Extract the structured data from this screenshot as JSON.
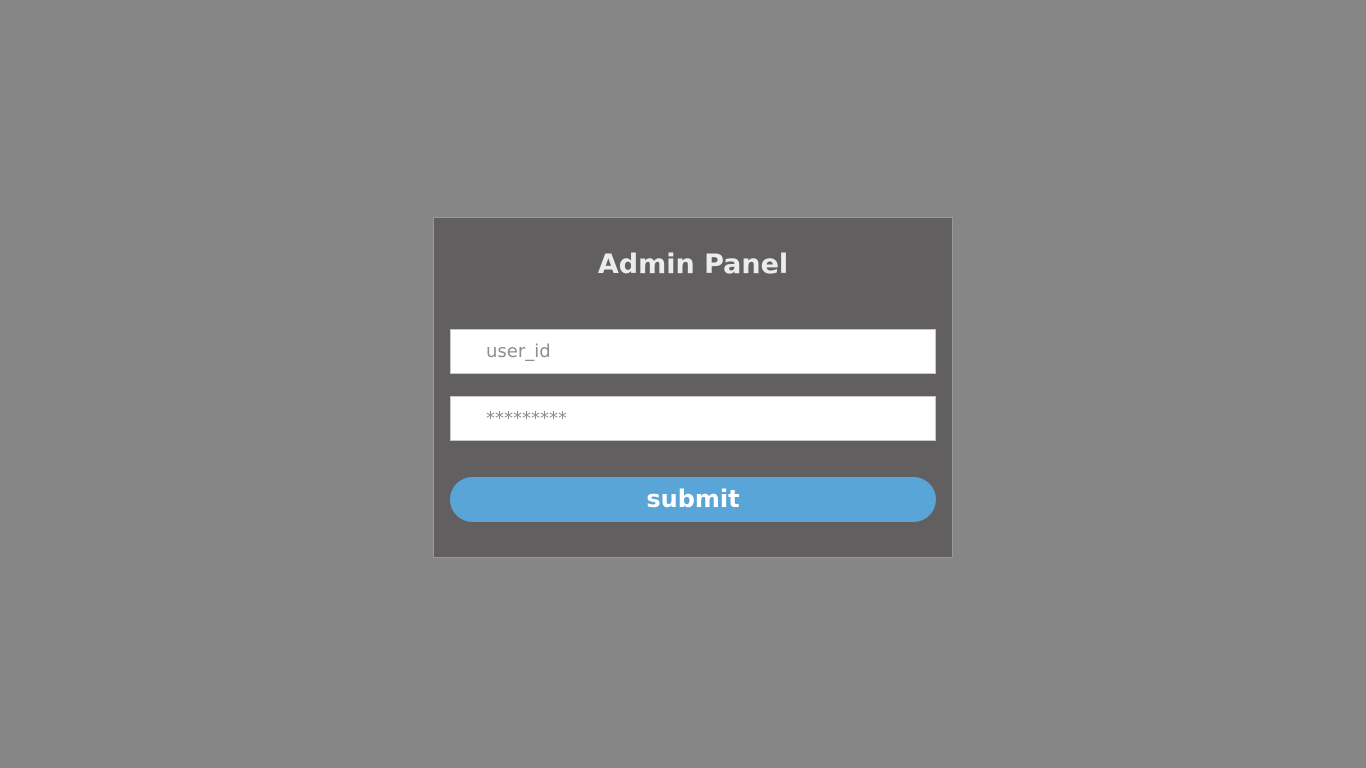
{
  "panel": {
    "title": "Admin Panel"
  },
  "form": {
    "user_field": {
      "placeholder": "user_id",
      "value": ""
    },
    "password_field": {
      "placeholder": "*********",
      "value": ""
    },
    "submit_label": "submit"
  },
  "colors": {
    "page_background": "#868686",
    "panel_background": "#625f60",
    "title_text": "#ececec",
    "submit_background": "#5aa5d8",
    "submit_text": "#ffffff"
  }
}
